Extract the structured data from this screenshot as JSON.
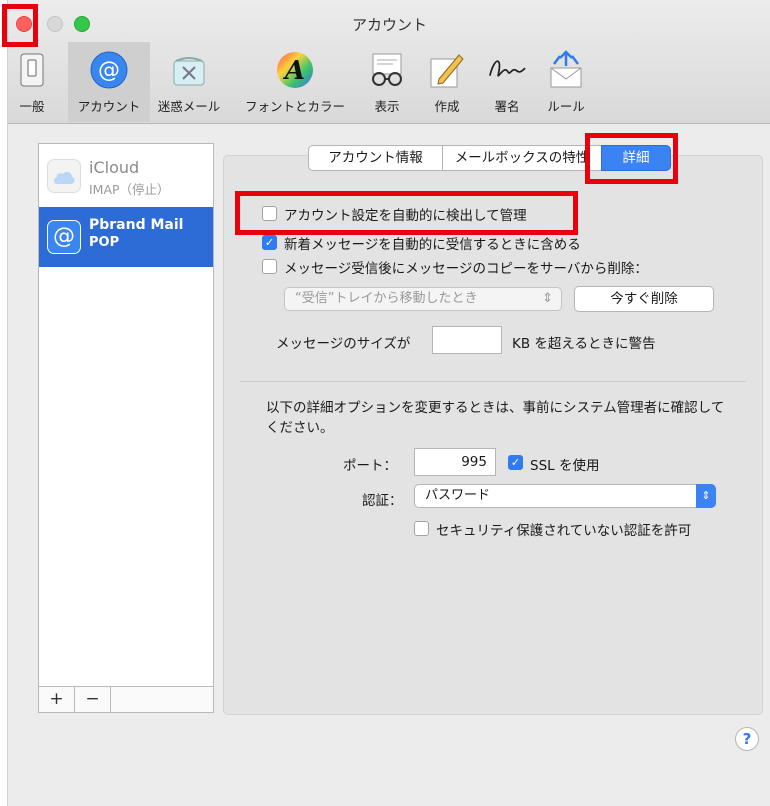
{
  "window": {
    "title": "アカウント"
  },
  "toolbar": {
    "items": [
      {
        "label": "一般",
        "icon": "switch-icon"
      },
      {
        "label": "アカウント",
        "icon": "at-sign-icon"
      },
      {
        "label": "迷惑メール",
        "icon": "junk-trash-icon"
      },
      {
        "label": "フォントとカラー",
        "icon": "font-a-icon"
      },
      {
        "label": "表示",
        "icon": "glasses-icon"
      },
      {
        "label": "作成",
        "icon": "pencil-icon"
      },
      {
        "label": "署名",
        "icon": "signature-icon"
      },
      {
        "label": "ルール",
        "icon": "rules-envelope-icon"
      }
    ],
    "selected": "アカウント"
  },
  "sidebar": {
    "accounts": [
      {
        "name": "iCloud",
        "sub": "IMAP（停止）",
        "icon": "cloud-icon"
      },
      {
        "name": "Pbrand  Mail",
        "sub": "POP",
        "icon": "at-sign-icon"
      }
    ],
    "add_label": "+",
    "remove_label": "−"
  },
  "tabs": {
    "items": [
      "アカウント情報",
      "メールボックスの特性",
      "詳細"
    ],
    "selected": "詳細"
  },
  "options": {
    "auto_detect": {
      "label": "アカウント設定を自動的に検出して管理",
      "checked": false
    },
    "include_new": {
      "label": "新着メッセージを自動的に受信するときに含める",
      "checked": true
    },
    "delete_copy": {
      "label": "メッセージ受信後にメッセージのコピーをサーバから削除：",
      "checked": false
    },
    "delete_when": "“受信”トレイから移動したとき",
    "delete_now": "今すぐ削除",
    "size_prefix": "メッセージのサイズが",
    "size_value": "",
    "size_suffix": "KB を超えるときに警告"
  },
  "advanced": {
    "warning": "以下の詳細オプションを変更するときは、事前にシステム管理者に確認してください。",
    "port_label": "ポート：",
    "port_value": "995",
    "ssl": {
      "label": "SSL を使用",
      "checked": true
    },
    "auth_label": "認証：",
    "auth_value": "パスワード",
    "insecure_auth": {
      "label": "セキュリティ保護されていない認証を許可",
      "checked": false
    }
  },
  "help_label": "?",
  "colors": {
    "accent": "#2f7bef",
    "selection": "#2d6bd6",
    "callout": "#e8000d"
  }
}
